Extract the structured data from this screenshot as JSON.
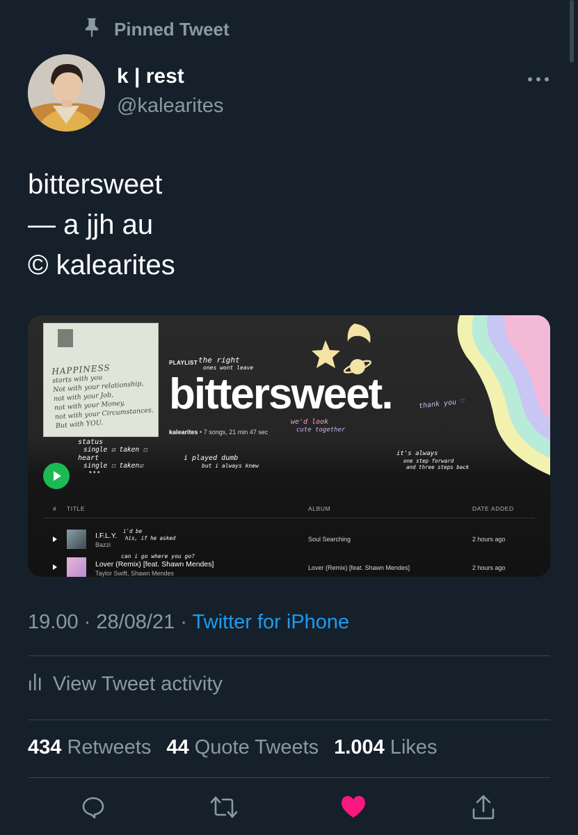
{
  "pinned_label": "Pinned Tweet",
  "author": {
    "display_name": "k | rest",
    "handle": "@kalearites"
  },
  "tweet_lines": [
    "bittersweet",
    "— a jjh au",
    "© kalearites"
  ],
  "card": {
    "playlist_label": "PLAYLIST",
    "playlist_title": "bittersweet.",
    "owner": "kalearites",
    "meta": " • 7 songs, 21 min 47 sec",
    "doodles": {
      "the_right": "the right",
      "ones_wont_leave": "ones wont leave",
      "thank_you": "thank you ♡",
      "we_d_look": "we'd look",
      "cute_together": "cute together",
      "status": "status",
      "status_row": "single ☑  taken ☐",
      "heart": "heart",
      "heart_row": "single ☐  taken☑",
      "played_dumb": "i played dumb",
      "but_i_always_knew": "but i always knew",
      "its_always": "it's always",
      "one_step_forward": "one step forward",
      "three_steps_back": "and three steps back",
      "id_be": "i'd be",
      "his_if_he_asked": "his, if he asked",
      "can_i_go": "can i go where you go?"
    },
    "cover_note": {
      "title": "HAPPINESS",
      "lines": [
        "starts with you",
        "Not with your relationship,",
        "not with your Job,",
        "not with your Money,",
        "not with your Circumstances.",
        "But with YOU."
      ]
    },
    "columns": {
      "number": "#",
      "title": "TITLE",
      "album": "ALBUM",
      "date_added": "DATE ADDED"
    },
    "tracks": [
      {
        "title": "I.F.L.Y.",
        "artist": "Bazzi",
        "album": "Soul Searching",
        "date": "2 hours ago"
      },
      {
        "title": "Lover (Remix) [feat. Shawn Mendes]",
        "artist": "Taylor Swift, Shawn Mendes",
        "album": "Lover (Remix) [feat. Shawn Mendes]",
        "date": "2 hours ago"
      }
    ]
  },
  "timestamp": {
    "time": "19.00",
    "date": "28/08/21",
    "source": "Twitter for iPhone"
  },
  "activity_label": "View Tweet activity",
  "stats": {
    "retweets": {
      "count": "434",
      "label": "Retweets"
    },
    "quotes": {
      "count": "44",
      "label": "Quote Tweets"
    },
    "likes": {
      "count": "1.004",
      "label": "Likes"
    }
  },
  "colors": {
    "background": "#15202b",
    "muted": "#8b98a5",
    "link": "#1d9bf0",
    "like": "#f91880",
    "spotify_green": "#1db954"
  },
  "icons": [
    "pin-icon",
    "more-icon",
    "play-icon",
    "activity-icon",
    "reply-icon",
    "retweet-icon",
    "like-icon",
    "share-icon"
  ]
}
